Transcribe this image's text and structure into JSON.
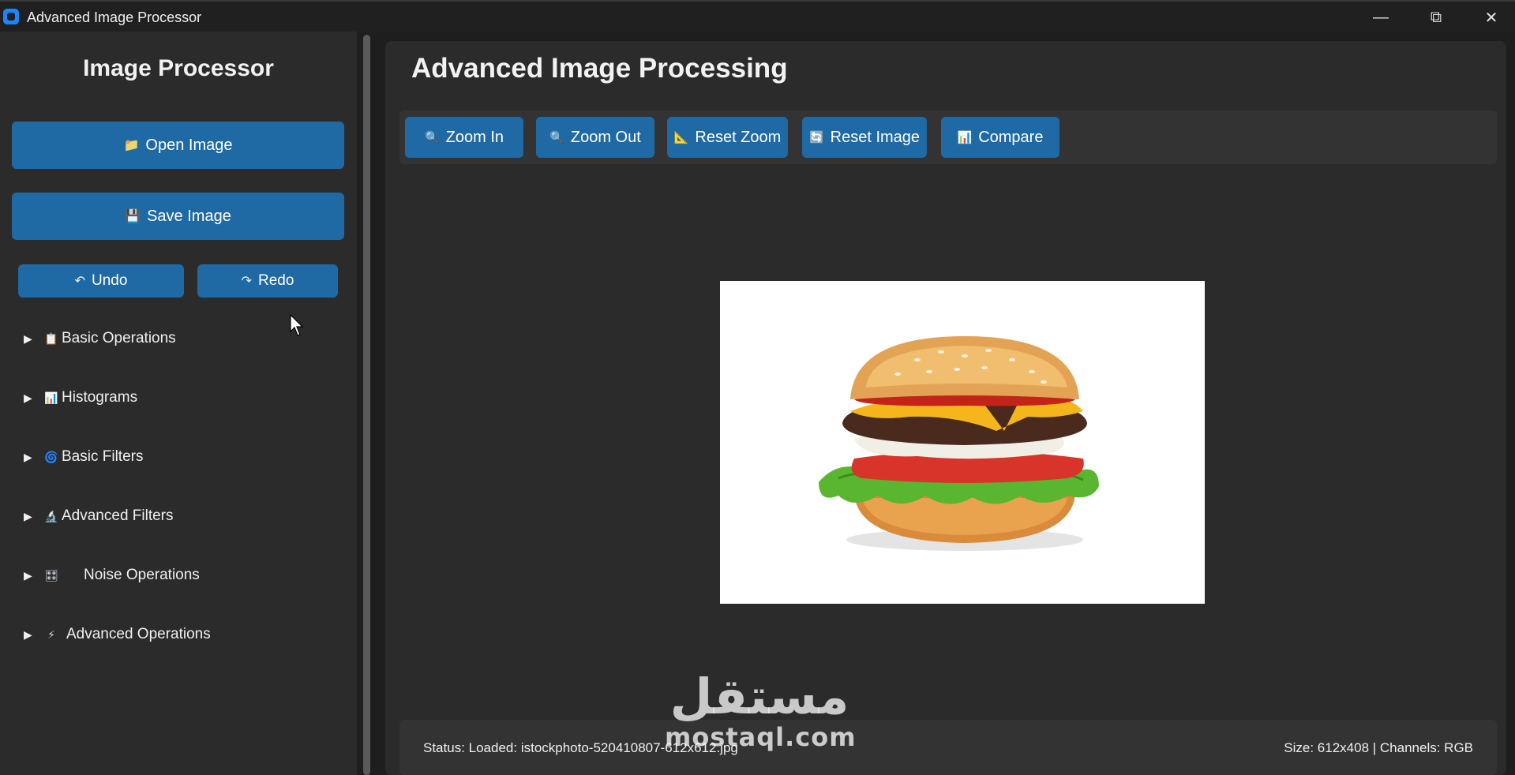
{
  "window": {
    "title": "Advanced Image Processor",
    "minimize": "—",
    "maximize": "⧉",
    "close": "✕"
  },
  "sidebar": {
    "title": "Image Processor",
    "open_label": "Open Image",
    "open_icon": "📁",
    "save_label": "Save Image",
    "save_icon": "💾",
    "undo_label": "Undo",
    "undo_icon": "↶",
    "redo_label": "Redo",
    "redo_icon": "↷",
    "sections": [
      {
        "label": "Basic Operations",
        "icon": "📋"
      },
      {
        "label": "Histograms",
        "icon": "📊"
      },
      {
        "label": "Basic Filters",
        "icon": "🌀"
      },
      {
        "label": "Advanced Filters",
        "icon": "🔬"
      },
      {
        "label": "Noise Operations",
        "icon": "🎛"
      },
      {
        "label": "Advanced Operations",
        "icon": "⚡"
      }
    ],
    "section_arrow": "▶"
  },
  "main": {
    "title": "Advanced Image Processing",
    "toolbar": [
      {
        "label": "Zoom In",
        "icon": "🔍"
      },
      {
        "label": "Zoom Out",
        "icon": "🔍"
      },
      {
        "label": "Reset Zoom",
        "icon": "📐"
      },
      {
        "label": "Reset Image",
        "icon": "🔄"
      },
      {
        "label": "Compare",
        "icon": "📊"
      }
    ],
    "image_subject": "burger"
  },
  "status": {
    "left": "Status: Loaded: istockphoto-520410807-612x612.jpg",
    "right": "Size: 612x408 | Channels: RGB"
  },
  "watermark": {
    "arabic": "مستقل",
    "latin": "mostaql.com"
  },
  "colors": {
    "accent": "#1f6aa5",
    "panel": "#2b2b2b",
    "background": "#1e1e1e"
  }
}
